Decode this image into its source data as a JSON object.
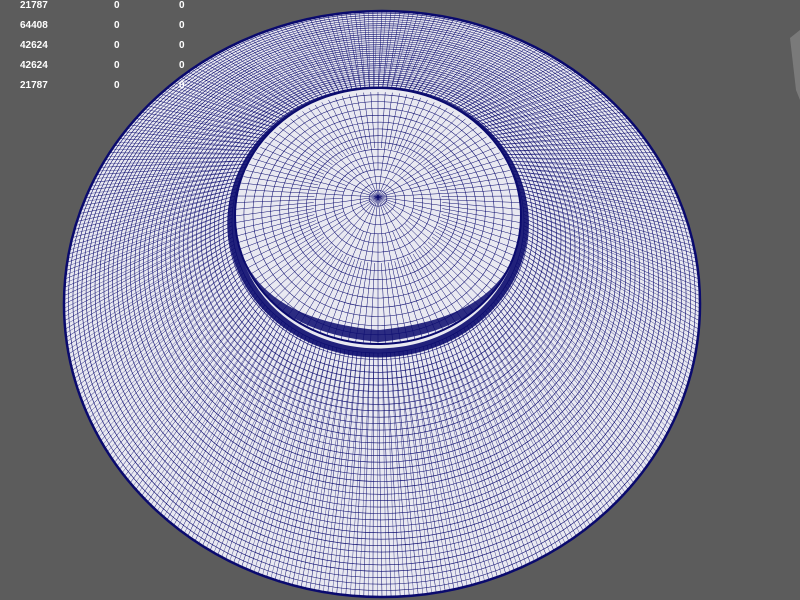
{
  "viewport": {
    "background_color": "#5c5c5c",
    "mesh_fill_color": "#e9e9f1",
    "wire_color": "#0b0b6e"
  },
  "stats": {
    "rows": [
      {
        "count": "21787",
        "a": "0",
        "b": "0"
      },
      {
        "count": "64408",
        "a": "0",
        "b": "0"
      },
      {
        "count": "42624",
        "a": "0",
        "b": "0"
      },
      {
        "count": "42624",
        "a": "0",
        "b": "0"
      },
      {
        "count": "21787",
        "a": "0",
        "b": "0"
      }
    ]
  },
  "model": {
    "description_icon": "wireframe-mesh-icon"
  }
}
